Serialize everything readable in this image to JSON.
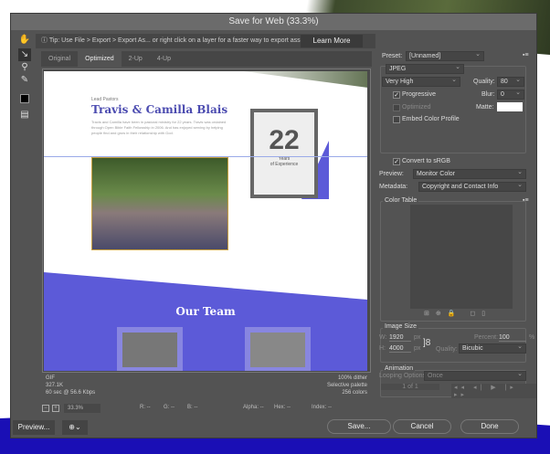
{
  "window": {
    "title": "Save for Web (33.3%)"
  },
  "tip": {
    "text": "Tip: Use File > Export > Export As...  or right click on a layer for a faster way to export assets",
    "learn_more": "Learn More"
  },
  "tabs": [
    "Original",
    "Optimized",
    "2-Up",
    "4-Up"
  ],
  "preview": {
    "subtitle": "Lead Pastors",
    "heading": "Travis & Camilla Blais",
    "body": "Travis and Camilla have been in pastoral ministry for 22 years. Travis was ordained through Open Bible Faith Fellowship in 2006. And has enjoyed serving by helping people find and grow in their relationship with God.",
    "years_number": "22",
    "years_label": "Years",
    "years_sub": "of Experience",
    "team_heading": "Our Team"
  },
  "info": {
    "format": "GIF",
    "size": "327.1K",
    "time": "60 sec @ 56.6 Kbps",
    "dither": "100% dither",
    "palette": "Selective palette",
    "colors": "256 colors"
  },
  "statusbar": {
    "zoom": "33.3%",
    "r": "R: --",
    "g": "G: --",
    "b": "B: --",
    "alpha": "Alpha: --",
    "hex": "Hex: --",
    "index": "Index: --"
  },
  "buttons": {
    "preview": "Preview...",
    "save": "Save...",
    "cancel": "Cancel",
    "done": "Done"
  },
  "settings": {
    "preset_label": "Preset:",
    "preset": "[Unnamed]",
    "format": "JPEG",
    "quality_preset": "Very High",
    "quality_label": "Quality:",
    "quality": "80",
    "progressive": "Progressive",
    "blur_label": "Blur:",
    "blur": "0",
    "optimized": "Optimized",
    "matte_label": "Matte:",
    "embed": "Embed Color Profile",
    "convert": "Convert to sRGB",
    "preview_label": "Preview:",
    "preview_value": "Monitor Color",
    "metadata_label": "Metadata:",
    "metadata_value": "Copyright and Contact Info",
    "color_table": "Color Table"
  },
  "image_size": {
    "title": "Image Size",
    "w_label": "W:",
    "w": "1920",
    "h_label": "H:",
    "h": "4000",
    "unit": "px",
    "percent_label": "Percent:",
    "percent": "100",
    "pct": "%",
    "quality_label": "Quality:",
    "quality": "Bicubic"
  },
  "animation": {
    "title": "Animation",
    "looping_label": "Looping Options:",
    "looping": "Once",
    "frame": "1 of 1"
  }
}
